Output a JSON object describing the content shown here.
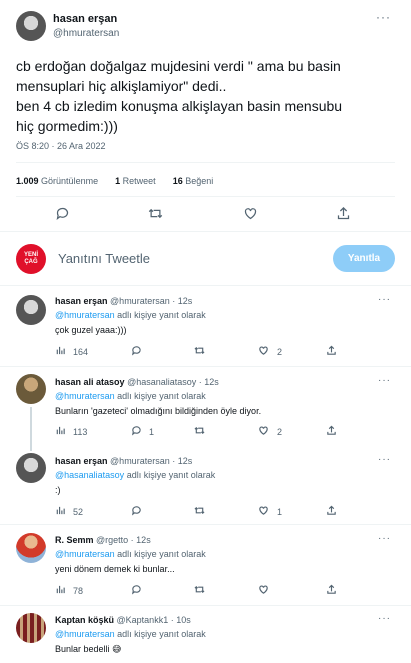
{
  "main_tweet": {
    "author_name": "hasan erşan",
    "author_handle": "@hmuratersan",
    "text_line1": "cb erdoğan doğalgaz mujdesini verdi \" ama bu basin",
    "text_line2": "mensuplari hiç alkişlamiyor\" dedi..",
    "text_line3": "ben 4 cb izledim konuşma alkişlayan basin mensubu",
    "text_line4": "hiç gormedim:)))",
    "timestamp": "ÖS 8:20 · 26 Ara 2022",
    "stats": {
      "views_count": "1.009",
      "views_label": "Görüntülenme",
      "retweets_count": "1",
      "retweets_label": "Retweet",
      "likes_count": "16",
      "likes_label": "Beğeni"
    }
  },
  "reply_box": {
    "avatar_text_1": "YENİ",
    "avatar_text_2": "ÇAĞ",
    "placeholder": "Yanıtını Tweetle",
    "button_label": "Yanıtla"
  },
  "replies": [
    {
      "name": "hasan erşan",
      "handle": "@hmuratersan · 12s",
      "reply_to": "@hmuratersan",
      "reply_suffix": " adlı kişiye yanıt olarak",
      "text": "çok guzel yaaa:)))",
      "views": "164",
      "replies": "",
      "retweets": "",
      "likes": "2"
    },
    {
      "name": "hasan ali atasoy",
      "handle": "@hasanaliatasoy · 12s",
      "reply_to": "@hmuratersan",
      "reply_suffix": " adlı kişiye yanıt olarak",
      "text": "Bunların 'gazeteci' olmadığını bildiğinden öyle diyor.",
      "views": "113",
      "replies": "1",
      "retweets": "",
      "likes": "2"
    },
    {
      "name": "hasan erşan",
      "handle": "@hmuratersan · 12s",
      "reply_to": "@hasanaliatasoy",
      "reply_suffix": " adlı kişiye yanıt olarak",
      "text": ":)",
      "views": "52",
      "replies": "",
      "retweets": "",
      "likes": "1"
    },
    {
      "name": "R. Semm",
      "handle": "@rgetto · 12s",
      "reply_to": "@hmuratersan",
      "reply_suffix": " adlı kişiye yanıt olarak",
      "text": "yeni dönem demek ki bunlar...",
      "views": "78",
      "replies": "",
      "retweets": "",
      "likes": ""
    },
    {
      "name": "Kaptan köşkü",
      "handle": "@Kaptankk1 · 10s",
      "reply_to": "@hmuratersan",
      "reply_suffix": " adlı kişiye yanıt olarak",
      "text": "Bunlar bedelli 😅"
    }
  ],
  "colors": {
    "accent": "#1d9bf0",
    "button_disabled": "#8ecdf8",
    "text_secondary": "#536471",
    "divider": "#eff3f4",
    "brand_red": "#e0102a"
  }
}
